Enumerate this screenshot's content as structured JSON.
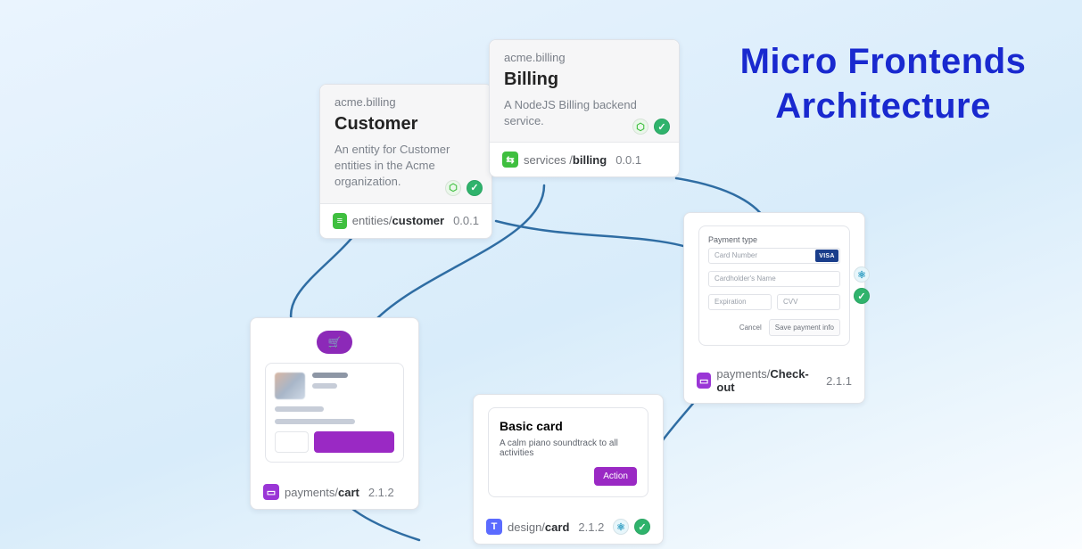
{
  "title_line1": "Micro Frontends",
  "title_line2": "Architecture",
  "customer": {
    "scope": "acme.billing",
    "name": "Customer",
    "desc": "An entity for Customer entities in the Acme organization.",
    "icon_glyph": "≡",
    "path_prefix": "entities/",
    "path_name": "customer",
    "version": "0.0.1"
  },
  "billing": {
    "scope": "acme.billing",
    "name": "Billing",
    "desc": "A NodeJS Billing backend service.",
    "icon_glyph": "⇆",
    "path_prefix": "services /",
    "path_name": "billing",
    "version": "0.0.1"
  },
  "checkout": {
    "title": "Payment type",
    "card_number_ph": "Card Number",
    "visa_tag": "VISA",
    "holder_ph": "Cardholder's Name",
    "exp_ph": "Expiration",
    "cvv_ph": "CVV",
    "cancel": "Cancel",
    "save": "Save payment info",
    "icon_glyph": "▭",
    "path_prefix": "payments/",
    "path_name": "Check-out",
    "version": "2.1.1"
  },
  "cart": {
    "cart_glyph": "🛒",
    "icon_glyph": "▭",
    "path_prefix": "payments/",
    "path_name": "cart",
    "version": "2.1.2"
  },
  "design_card": {
    "title": "Basic card",
    "body": "A calm piano soundtrack to all activities",
    "action": "Action",
    "icon_glyph": "T",
    "path_prefix": "design/",
    "path_name": "card",
    "version": "2.1.2"
  },
  "check_glyph": "✓",
  "react_glyph": "⚛"
}
